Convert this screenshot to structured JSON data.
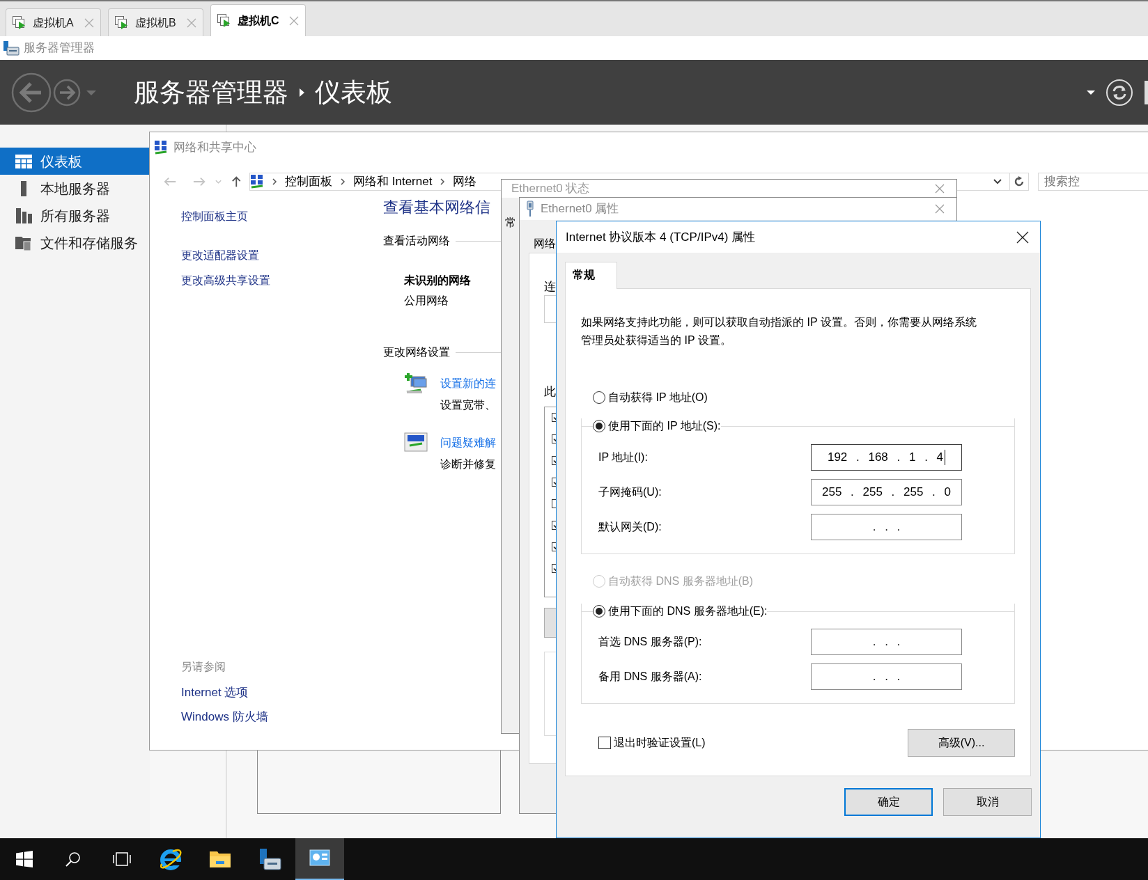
{
  "vm_tabs": [
    {
      "label": "虚拟机A",
      "selected": false
    },
    {
      "label": "虚拟机B",
      "selected": false
    },
    {
      "label": "虚拟机C",
      "selected": true
    }
  ],
  "app_title": "服务器管理器",
  "header": {
    "crumbs": [
      "服务器管理器",
      "仪表板"
    ]
  },
  "sidebar": {
    "items": [
      {
        "label": "仪表板",
        "kind": "dashboard",
        "selected": true
      },
      {
        "label": "本地服务器",
        "kind": "server",
        "selected": false
      },
      {
        "label": "所有服务器",
        "kind": "servers",
        "selected": false
      },
      {
        "label": "文件和存储服务",
        "kind": "storage",
        "selected": false
      }
    ]
  },
  "network_center": {
    "title": "网络和共享中心",
    "address": [
      "控制面板",
      "网络和 Internet",
      "网络"
    ],
    "search_placeholder": "搜索控",
    "tasks": [
      "控制面板主页",
      "更改适配器设置",
      "更改高级共享设置"
    ],
    "see_also_heading": "另请参阅",
    "see_also": [
      "Internet 选项",
      "Windows 防火墙"
    ],
    "heading": "查看基本网络信",
    "active_heading": "查看活动网络",
    "network_name": "未识别的网络",
    "network_type": "公用网络",
    "change_heading": "更改网络设置",
    "actions": [
      {
        "kind": "new",
        "title": "设置新的连",
        "desc": "设置宽带、"
      },
      {
        "kind": "troubleshoot",
        "title": "问题疑难解",
        "desc": "诊断并修复"
      }
    ]
  },
  "ethernet_status": {
    "title": "Ethernet0 状态",
    "tab": "常"
  },
  "ethernet_properties": {
    "title": "Ethernet0 属性",
    "tab": "网络",
    "labels": [
      "连",
      "此"
    ],
    "components": [
      {
        "checked": true
      },
      {
        "checked": true
      },
      {
        "checked": true
      },
      {
        "checked": true
      },
      {
        "checked": false
      },
      {
        "checked": true
      },
      {
        "checked": true
      },
      {
        "checked": true
      }
    ]
  },
  "ipv4": {
    "title": "Internet 协议版本 4 (TCP/IPv4) 属性",
    "tab": {
      "label": "常规",
      "selected": true
    },
    "description": "如果网络支持此功能，则可以获取自动指派的 IP 设置。否则，你需要从网络系统管理员处获得适当的 IP 设置。",
    "ip_mode": [
      {
        "label": "自动获得 IP 地址(O)",
        "selected": false,
        "disabled": false
      },
      {
        "label": "使用下面的 IP 地址(S):",
        "selected": true,
        "disabled": false
      }
    ],
    "ip_fields": [
      {
        "label": "IP 地址(I):",
        "value": "192 . 168 . 1 . 4",
        "focused": true
      },
      {
        "label": "子网掩码(U):",
        "value": "255 . 255 . 255 . 0",
        "focused": false
      },
      {
        "label": "默认网关(D):",
        "value": ". . .",
        "focused": false
      }
    ],
    "dns_mode": [
      {
        "label": "自动获得 DNS 服务器地址(B)",
        "selected": false,
        "disabled": true
      },
      {
        "label": "使用下面的 DNS 服务器地址(E):",
        "selected": true,
        "disabled": false
      }
    ],
    "dns_fields": [
      {
        "label": "首选 DNS 服务器(P):",
        "value": ". . .",
        "focused": false
      },
      {
        "label": "备用 DNS 服务器(A):",
        "value": ". . .",
        "focused": false
      }
    ],
    "validate": {
      "label": "退出时验证设置(L)",
      "checked": false
    },
    "advanced": "高级(V)...",
    "buttons": [
      {
        "label": "确定",
        "default": true
      },
      {
        "label": "取消",
        "default": false
      }
    ]
  },
  "taskbar": [
    {
      "kind": "start",
      "selected": false
    },
    {
      "kind": "search",
      "selected": false
    },
    {
      "kind": "taskview",
      "selected": false
    },
    {
      "kind": "browser",
      "selected": false
    },
    {
      "kind": "folder",
      "selected": false
    },
    {
      "kind": "server-manager",
      "selected": false
    },
    {
      "kind": "control-panel",
      "selected": true
    }
  ]
}
